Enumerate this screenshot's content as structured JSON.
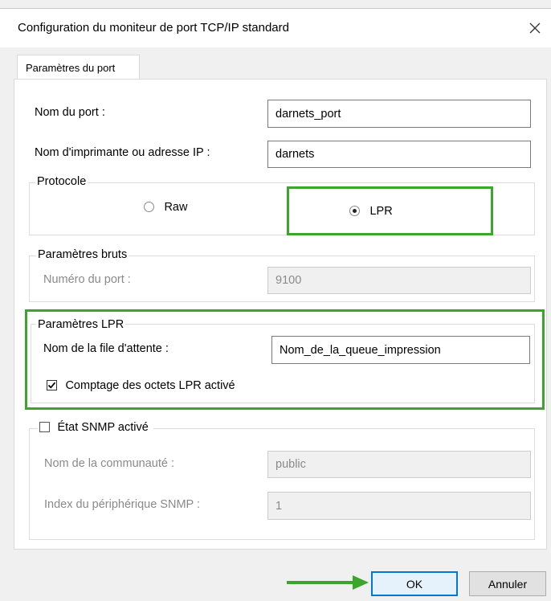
{
  "window": {
    "title": "Configuration du moniteur de port TCP/IP standard",
    "close_icon": "close-icon"
  },
  "tab": {
    "label": "Paramètres du port"
  },
  "port_name": {
    "label": "Nom du port :",
    "value": "darnets_port"
  },
  "printer": {
    "label": "Nom d'imprimante ou adresse IP :",
    "value": "darnets"
  },
  "protocol": {
    "legend": "Protocole",
    "raw_label": "Raw",
    "lpr_label": "LPR",
    "selected": "LPR"
  },
  "raw_settings": {
    "legend": "Paramètres bruts",
    "port_number_label": "Numéro du port :",
    "port_number_value": "9100"
  },
  "lpr_settings": {
    "legend": "Paramètres LPR",
    "queue_label": "Nom de la file d'attente :",
    "queue_value": "Nom_de_la_queue_impression",
    "byte_counting_label": "Comptage des octets LPR activé",
    "byte_counting_checked": true
  },
  "snmp": {
    "label": "État SNMP activé",
    "checked": false,
    "community_label": "Nom de la communauté :",
    "community_value": "public",
    "device_index_label": "Index du périphérique SNMP :",
    "device_index_value": "1"
  },
  "buttons": {
    "ok": "OK",
    "cancel": "Annuler"
  },
  "colors": {
    "highlight": "#3aa62b",
    "focus": "#0078d7"
  }
}
